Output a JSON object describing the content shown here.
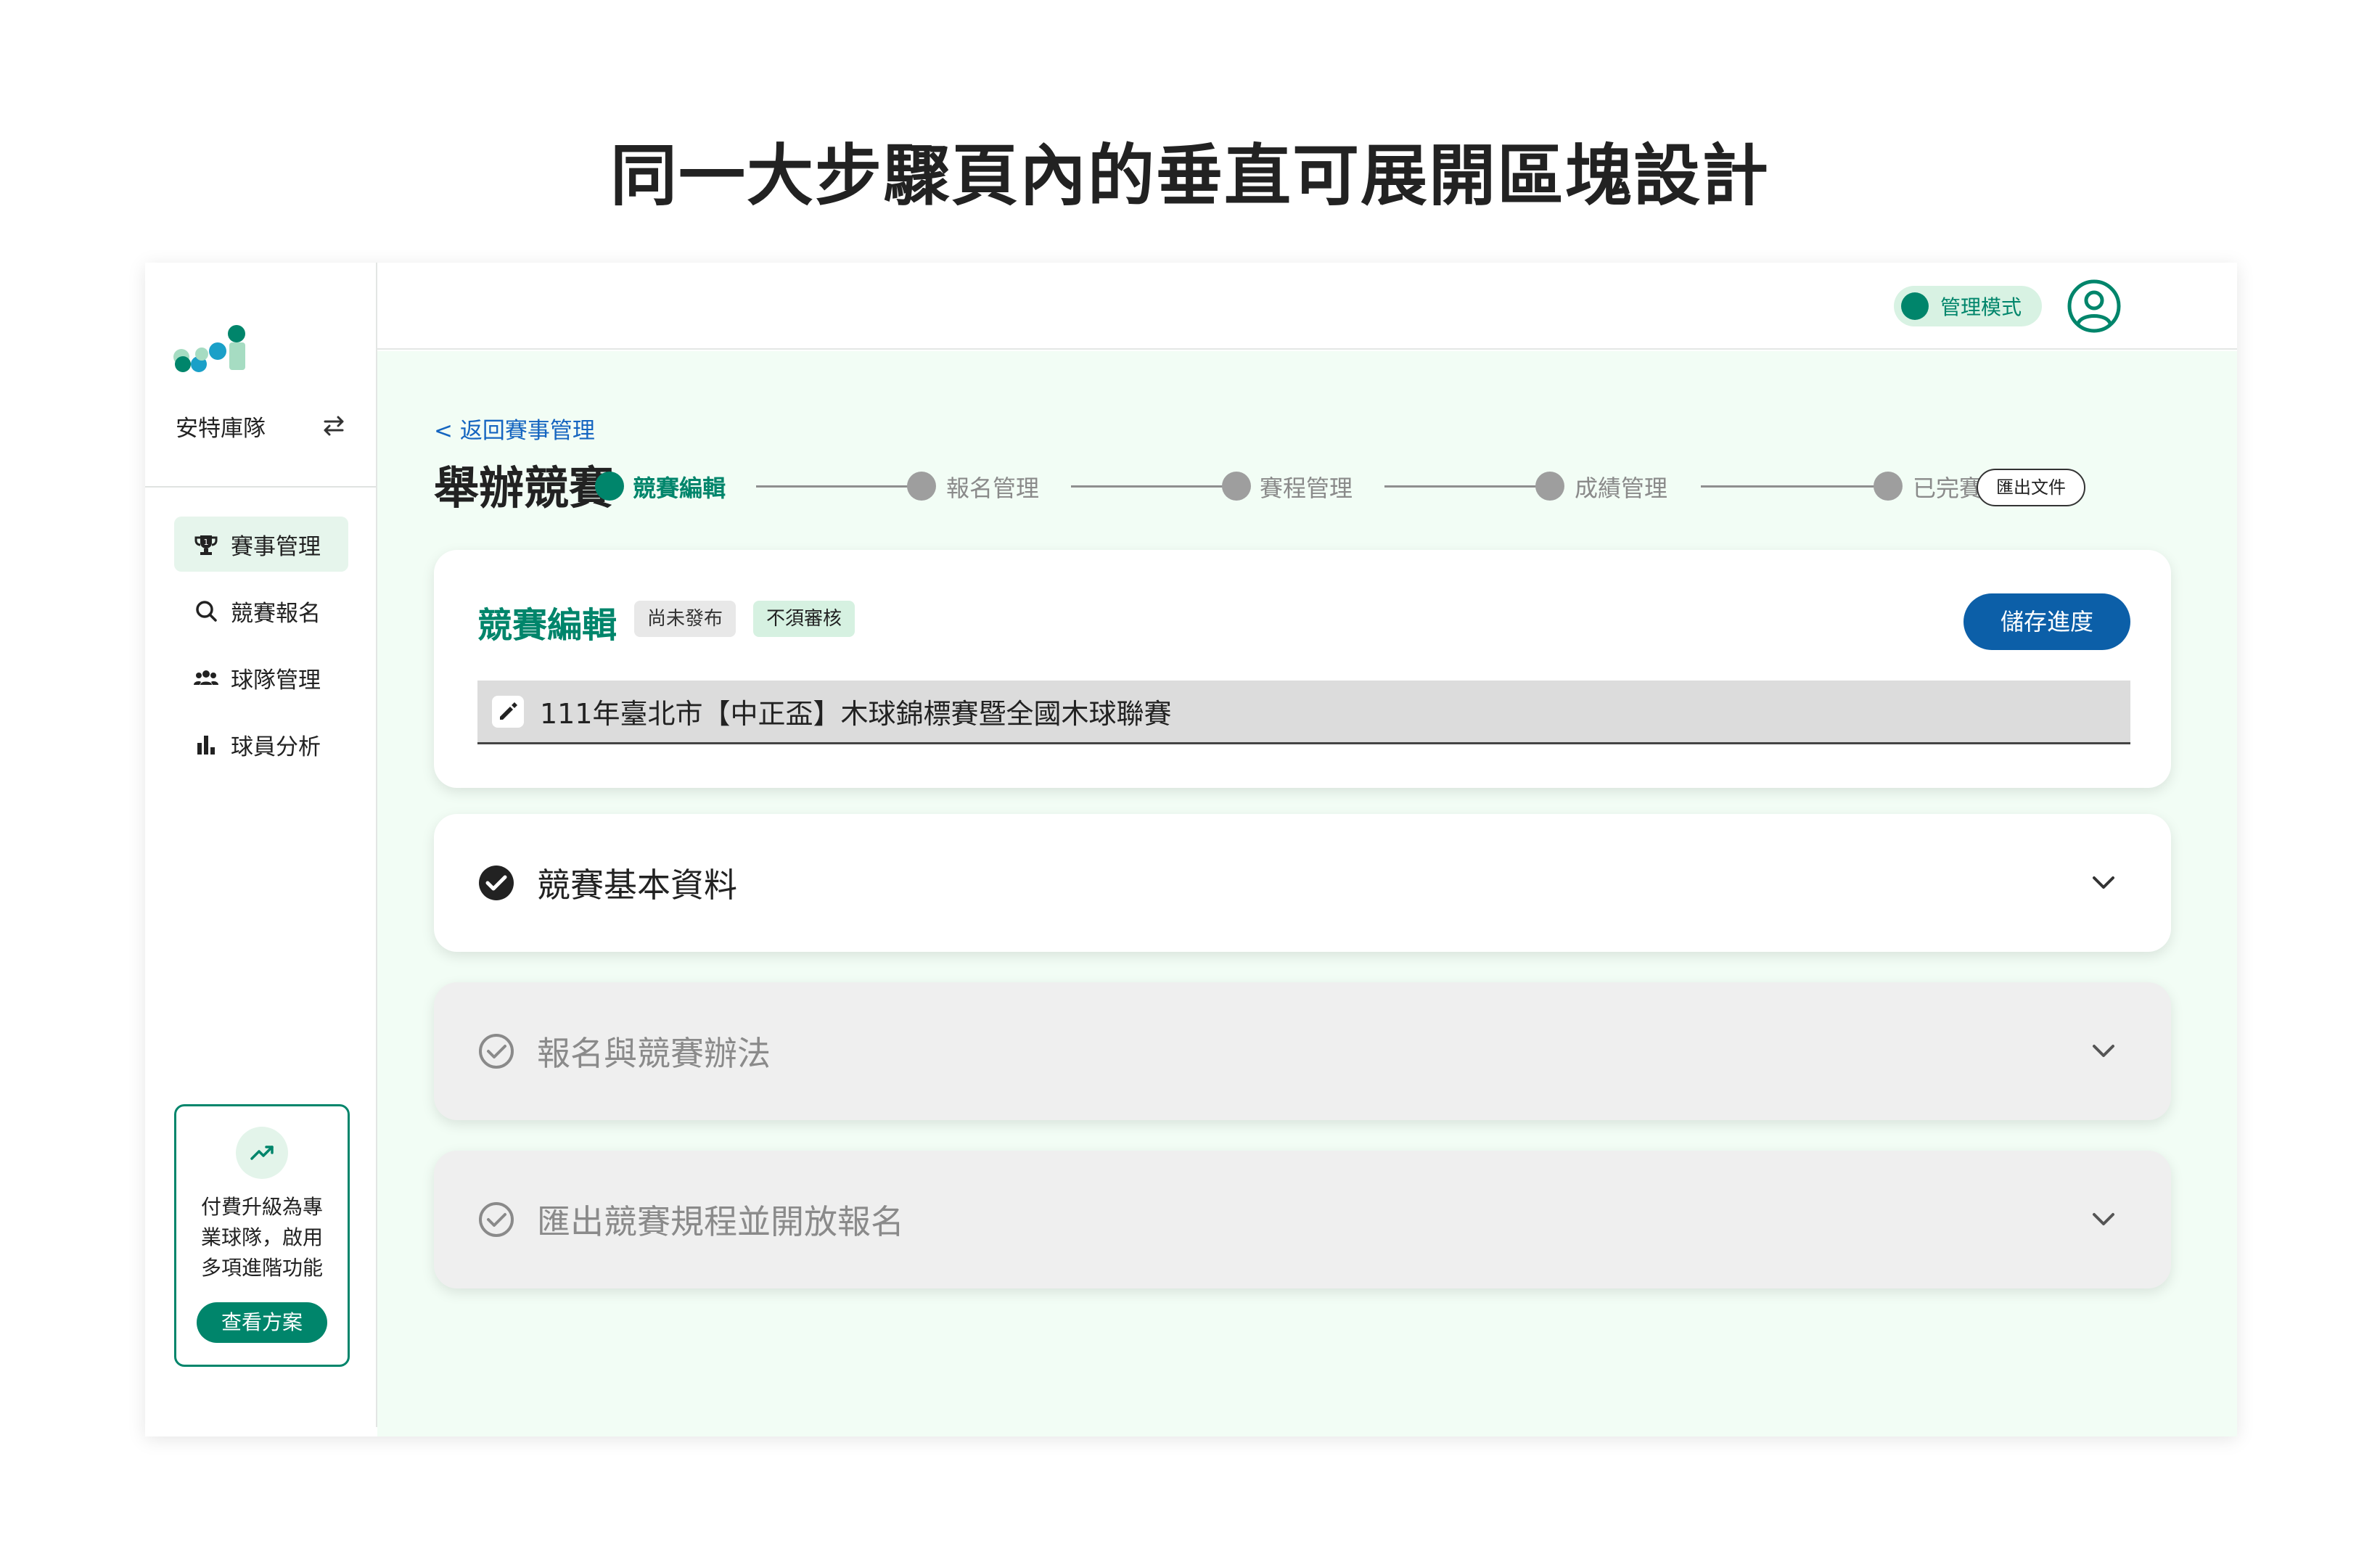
{
  "page_heading": "同一大步驟頁內的垂直可展開區塊設計",
  "sidebar": {
    "team_name": "安特庫隊",
    "items": [
      {
        "label": "賽事管理",
        "icon": "trophy-icon",
        "active": true
      },
      {
        "label": "競賽報名",
        "icon": "search-icon",
        "active": false
      },
      {
        "label": "球隊管理",
        "icon": "group-icon",
        "active": false
      },
      {
        "label": "球員分析",
        "icon": "bar-chart-icon",
        "active": false
      }
    ],
    "upgrade": {
      "text_line1": "付費升級為專",
      "text_line2": "業球隊，啟用",
      "text_line3": "多項進階功能",
      "button_label": "查看方案"
    }
  },
  "topbar": {
    "mode_label": "管理模式"
  },
  "main": {
    "back_link": "< 返回賽事管理",
    "title": "舉辦競賽",
    "steps": [
      "競賽編輯",
      "報名管理",
      "賽程管理",
      "成績管理",
      "已完賽"
    ],
    "active_step": 0,
    "export_label": "匯出文件",
    "edit_card": {
      "title": "競賽編輯",
      "badge_unpublished": "尚未發布",
      "badge_no_review": "不須審核",
      "save_label": "儲存進度",
      "competition_name": "111年臺北市【中正盃】木球錦標賽暨全國木球聯賽"
    },
    "sections": [
      {
        "label": "競賽基本資料",
        "status": "completed"
      },
      {
        "label": "報名與競賽辦法",
        "status": "pending"
      },
      {
        "label": "匯出競賽規程並開放報名",
        "status": "pending"
      }
    ]
  },
  "colors": {
    "accent": "#00856b",
    "primary_button": "#0c5fa8",
    "link": "#1565c0",
    "main_background": "#f2fdf5"
  }
}
